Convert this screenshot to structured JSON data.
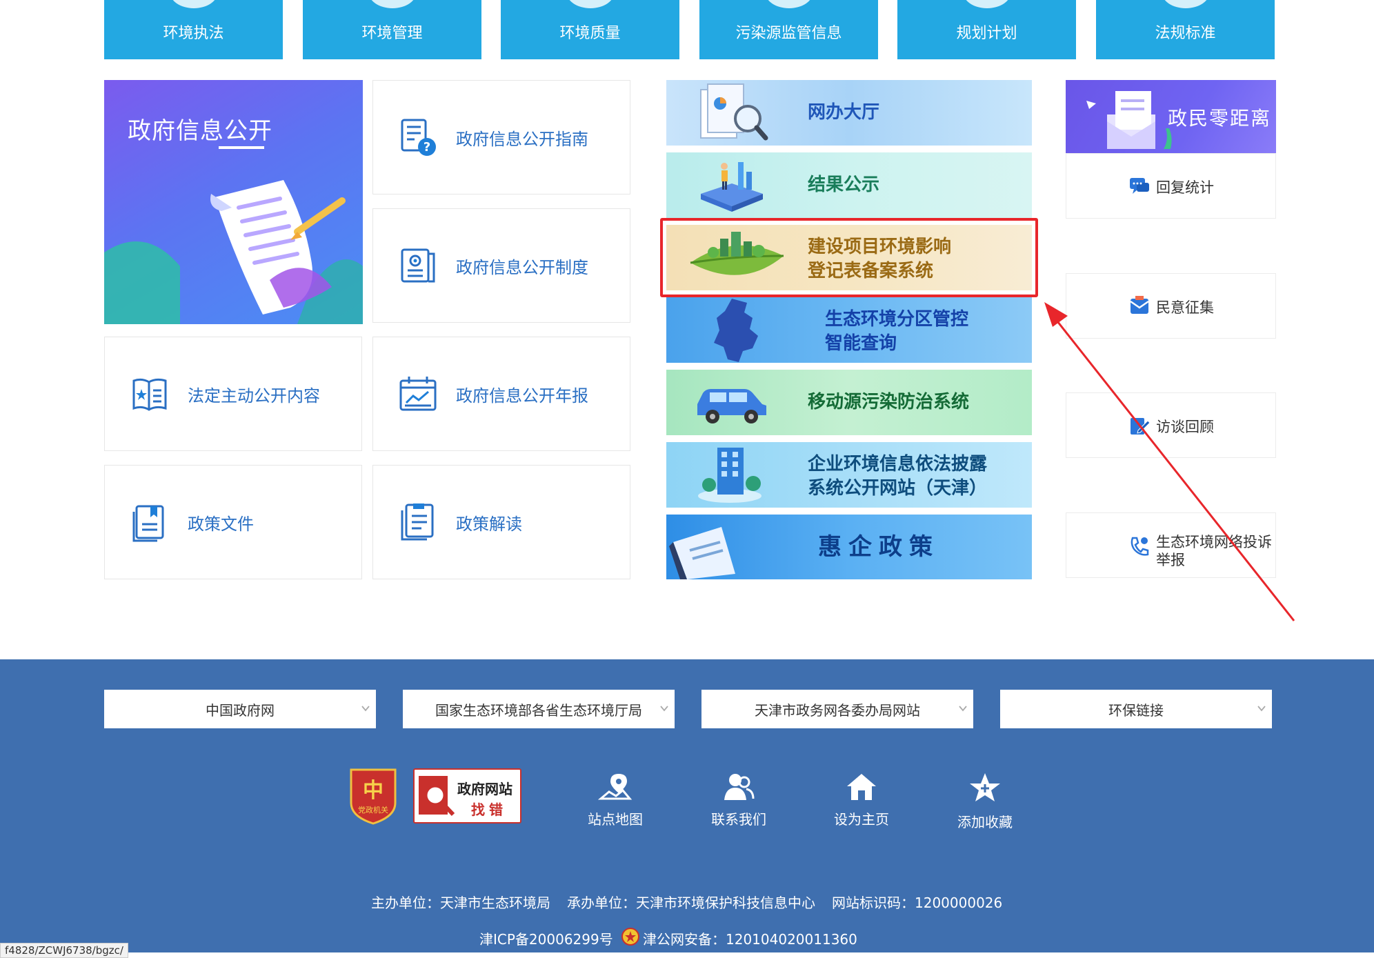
{
  "top_nav": [
    "环境执法",
    "环境管理",
    "环境质量",
    "污染源监管信息",
    "规划计划",
    "法规标准"
  ],
  "gov_info": {
    "hero_title": "政府信息公开",
    "items": [
      {
        "label": "政府信息公开指南",
        "icon": "doc-question-icon"
      },
      {
        "label": "政府信息公开制度",
        "icon": "doc-badge-icon"
      },
      {
        "label": "法定主动公开内容",
        "icon": "book-star-icon"
      },
      {
        "label": "政府信息公开年报",
        "icon": "calendar-chart-icon"
      },
      {
        "label": "政策文件",
        "icon": "file-bookmark-icon"
      },
      {
        "label": "政策解读",
        "icon": "file-list-icon"
      }
    ]
  },
  "banners": [
    {
      "line1": "网办大厅",
      "line2": ""
    },
    {
      "line1": "结果公示",
      "line2": ""
    },
    {
      "line1": "建设项目环境影响",
      "line2": "登记表备案系统"
    },
    {
      "line1": "生态环境分区管控",
      "line2": "智能查询"
    },
    {
      "line1": "移动源污染防治系统",
      "line2": ""
    },
    {
      "line1": "企业环境信息依法披露",
      "line2": "系统公开网站（天津）"
    },
    {
      "line1": "惠企政策",
      "line2": ""
    }
  ],
  "side": {
    "header": "政民零距离",
    "items": [
      {
        "label": "回复统计",
        "icon": "chat-icon"
      },
      {
        "label": "民意征集",
        "icon": "mail-icon"
      },
      {
        "label": "访谈回顾",
        "icon": "edit-icon"
      },
      {
        "label_line1": "生态环境网络投诉",
        "label_line2": "举报",
        "icon": "phone-icon"
      }
    ]
  },
  "footer": {
    "selects": [
      "中国政府网",
      "国家生态环境部各省生态环境厅局",
      "天津市政务网各委办局网站",
      "环保链接"
    ],
    "badges": {
      "party_text": "党政机关",
      "gov_site_line1": "政府网站",
      "gov_site_line2": "找错"
    },
    "links": [
      "站点地图",
      "联系我们",
      "设为主页",
      "添加收藏"
    ],
    "host": "主办单位：天津市生态环境局",
    "organizer": "承办单位：天津市环境保护科技信息中心",
    "site_code": "网站标识码：1200000026",
    "icp": "津ICP备20006299号",
    "police": "津公网安备：120104020011360",
    "status_url": "f4828/ZCWJ6738/bgzc/"
  },
  "colors": {
    "nav_blue": "#23a8e2",
    "footer_blue": "#3f6faf",
    "link_blue": "#2a6fc3",
    "highlight_red": "#e8262b"
  }
}
